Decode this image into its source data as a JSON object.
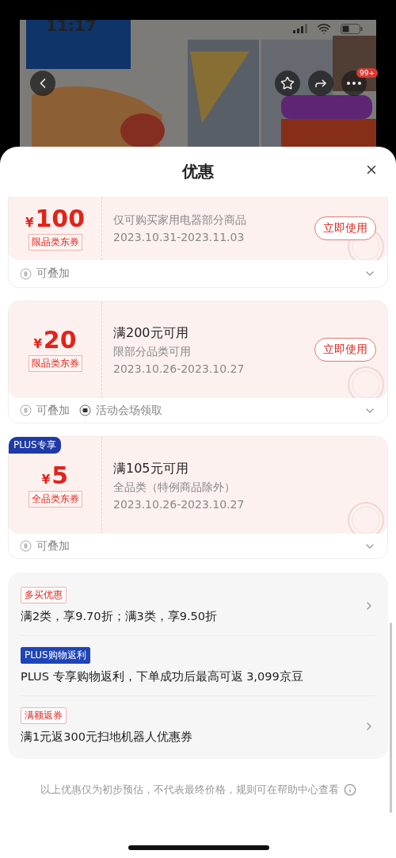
{
  "status_bar": {
    "time": "11:17"
  },
  "product_nav": {
    "more_badge": "99+"
  },
  "sheet": {
    "title": "优惠"
  },
  "coupons": [
    {
      "currency": "¥",
      "amount": "100",
      "scope_tag": "限品类东券",
      "description": "仅可购买家用电器部分商品",
      "validity": "2023.10.31-2023.11.03",
      "action": "立即使用",
      "features": [
        {
          "kind": "stack",
          "label": "可叠加"
        }
      ]
    },
    {
      "currency": "¥",
      "amount": "20",
      "scope_tag": "限品类东券",
      "title": "满200元可用",
      "description": "限部分品类可用",
      "validity": "2023.10.26-2023.10.27",
      "action": "立即使用",
      "features": [
        {
          "kind": "stack",
          "label": "可叠加"
        },
        {
          "kind": "venue",
          "label": "活动会场领取"
        }
      ]
    },
    {
      "plus_badge": "PLUS专享",
      "currency": "¥",
      "amount": "5",
      "scope_tag": "全品类东券",
      "title": "满105元可用",
      "description": "全品类（特例商品除外）",
      "validity": "2023.10.26-2023.10.27",
      "features": [
        {
          "kind": "stack",
          "label": "可叠加"
        }
      ]
    }
  ],
  "promotions": [
    {
      "tag": "多买优惠",
      "kind": "outline",
      "text": "满2类，享9.70折；满3类，享9.50折",
      "arrow": true
    },
    {
      "tag": "PLUS购物返利",
      "kind": "plus",
      "text": "PLUS 专享购物返利，下单成功后最高可返 3,099京豆",
      "arrow": false
    },
    {
      "tag": "满额返券",
      "kind": "outline",
      "text": "满1元返300元扫地机器人优惠券",
      "arrow": true
    }
  ],
  "note": "以上优惠仅为初步预估，不代表最终价格，规则可在帮助中心查看"
}
